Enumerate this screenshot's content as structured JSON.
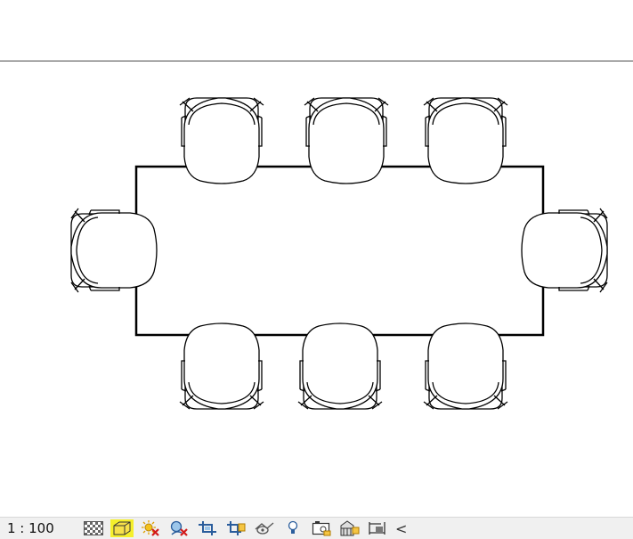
{
  "view_scale": "1 : 100",
  "view_bar": {
    "tools": [
      {
        "name": "detail-level-icon",
        "highlighted": false
      },
      {
        "name": "visual-style-icon",
        "highlighted": true
      },
      {
        "name": "sun-path-off-icon",
        "highlighted": false
      },
      {
        "name": "shadows-off-icon",
        "highlighted": false
      },
      {
        "name": "crop-view-icon",
        "highlighted": false
      },
      {
        "name": "show-crop-region-icon",
        "highlighted": false
      },
      {
        "name": "unlocked-3d-view-icon",
        "highlighted": false
      },
      {
        "name": "reveal-hidden-elements-icon",
        "highlighted": false
      },
      {
        "name": "temporary-hide-isolate-icon",
        "highlighted": false
      },
      {
        "name": "analytical-model-icon",
        "highlighted": false
      },
      {
        "name": "highlight-displacement-icon",
        "highlighted": false
      }
    ],
    "collapse_glyph": "<",
    "highlight_color": "#f5ef2b"
  }
}
